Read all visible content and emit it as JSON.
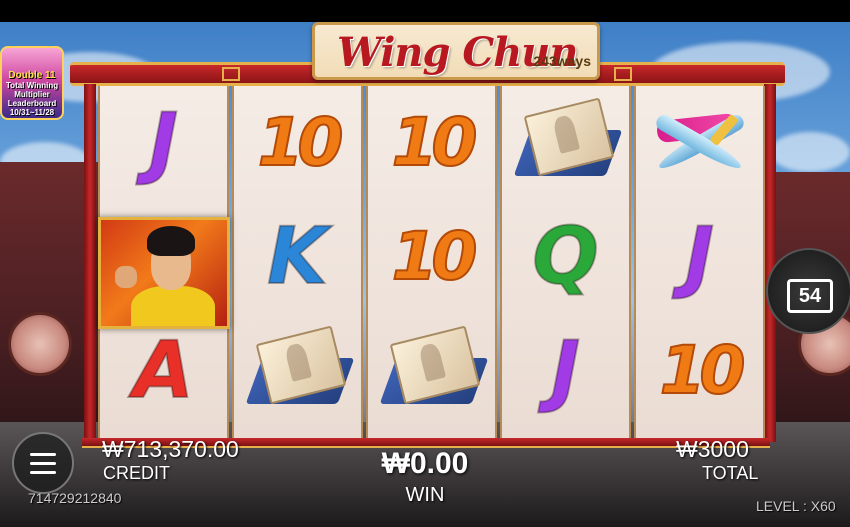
{
  "game": {
    "title": "Wing Chun",
    "ways": "243ways"
  },
  "promo": {
    "title": "Double 11",
    "line1": "Total Winning",
    "line2": "Multiplier Leaderboard",
    "dates": "10/31~11/28"
  },
  "reels": [
    [
      {
        "symbol": "J",
        "kind": "letter-j"
      },
      {
        "symbol": "wild",
        "kind": "hero"
      },
      {
        "symbol": "A",
        "kind": "letter-a"
      }
    ],
    [
      {
        "symbol": "10",
        "kind": "ten"
      },
      {
        "symbol": "K",
        "kind": "letter-k"
      },
      {
        "symbol": "scroll",
        "kind": "book"
      }
    ],
    [
      {
        "symbol": "10",
        "kind": "ten"
      },
      {
        "symbol": "10",
        "kind": "ten"
      },
      {
        "symbol": "scroll",
        "kind": "book"
      }
    ],
    [
      {
        "symbol": "scroll",
        "kind": "book"
      },
      {
        "symbol": "Q",
        "kind": "letter-q"
      },
      {
        "symbol": "J",
        "kind": "letter-j"
      }
    ],
    [
      {
        "symbol": "knives",
        "kind": "weapon"
      },
      {
        "symbol": "J",
        "kind": "letter-j"
      },
      {
        "symbol": "10",
        "kind": "ten"
      }
    ]
  ],
  "side_button": {
    "value": "54",
    "icon": "square-counter-icon"
  },
  "hud": {
    "credit_value": "₩713,370.00",
    "credit_label": "CREDIT",
    "win_value": "₩0.00",
    "win_label": "WIN",
    "total_value": "₩3000",
    "total_label": "TOTAL",
    "session_id": "714729212840",
    "level_text": "LEVEL : X60",
    "menu_icon": "hamburger-menu-icon"
  },
  "colors": {
    "frame_red": "#c7282a",
    "frame_gold": "#e6b04a",
    "title_red": "#b81820"
  }
}
